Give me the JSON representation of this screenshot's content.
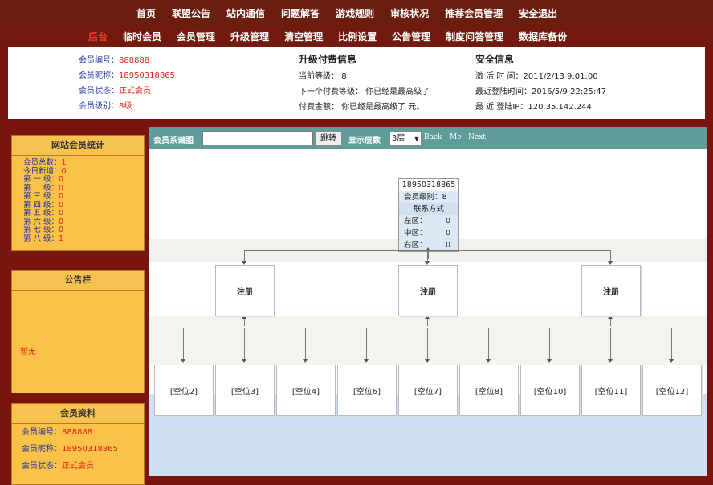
{
  "nav": {
    "top": [
      "首页",
      "联盟公告",
      "站内通信",
      "问题解答",
      "游戏规则",
      "审核状况",
      "推荐会员管理",
      "安全退出"
    ],
    "second": [
      "后台",
      "临时会员",
      "会员管理",
      "升级管理",
      "清空管理",
      "比例设置",
      "公告管理",
      "制度问答管理",
      "数据库备份"
    ]
  },
  "member_info": {
    "id_label": "会员编号：",
    "id_value": "888888",
    "nick_label": "会员昵称：",
    "nick_value": "18950318865",
    "status_label": "会员状态：",
    "status_value": "正式会员",
    "level_label": "会员级别：",
    "level_value": "8级"
  },
  "upgrade_info": {
    "title": "升级付费信息",
    "current_label": "当前等级：",
    "current_value": "8",
    "next_label": "下一个付费等级：",
    "next_value": "你已经是最高级了",
    "fee_label": "付费金额：",
    "fee_value": "你已经是最高级了 元。"
  },
  "security_info": {
    "title": "安全信息",
    "activate_label": "激 活 时 间：",
    "activate_value": "2011/2/13 9:01:00",
    "last_login_label": "最近登陆时间：",
    "last_login_value": "2016/5/9 22:25:47",
    "last_ip_label": "最 近 登陆IP：",
    "last_ip_value": "120.35.142.244"
  },
  "sidebar": {
    "stats_title": "网站会员统计",
    "stats": [
      {
        "k": "会员总数：",
        "v": "1"
      },
      {
        "k": "今日新增：",
        "v": "0"
      },
      {
        "k": "第 一 级：",
        "v": "0"
      },
      {
        "k": "第 二 级：",
        "v": "0"
      },
      {
        "k": "第 三 级：",
        "v": "0"
      },
      {
        "k": "第 四 级：",
        "v": "0"
      },
      {
        "k": "第 五 级：",
        "v": "0"
      },
      {
        "k": "第 六 级：",
        "v": "0"
      },
      {
        "k": "第 七 级：",
        "v": "0"
      },
      {
        "k": "第 八 级：",
        "v": "1"
      }
    ],
    "notice_title": "公告栏",
    "notice_text": "暂无",
    "profile_title": "会员资料",
    "profile": [
      {
        "k": "会员编号：",
        "v": "888888"
      },
      {
        "k": "会员昵称：",
        "v": "18950318865"
      },
      {
        "k": "会员状态：",
        "v": "正式会员"
      }
    ]
  },
  "toolbar": {
    "label": "会员系谱图",
    "search_value": "",
    "jump": "跳转",
    "layers_label": "显示层数",
    "layers_value": "3层",
    "back": "Back",
    "me": "Me",
    "next": "Next"
  },
  "tree": {
    "root": {
      "id": "18950318865",
      "level_label": "会员级别：",
      "level": "8",
      "contact": "联系方式",
      "left_label": "左区：",
      "left": "0",
      "mid_label": "中区：",
      "mid": "0",
      "right_label": "右区：",
      "right": "0"
    },
    "level2": [
      "注册",
      "注册",
      "注册"
    ],
    "level3": [
      "[空位2]",
      "[空位3]",
      "[空位4]",
      "[空位6]",
      "[空位7]",
      "[空位8]",
      "[空位10]",
      "[空位11]",
      "[空位12]"
    ]
  }
}
